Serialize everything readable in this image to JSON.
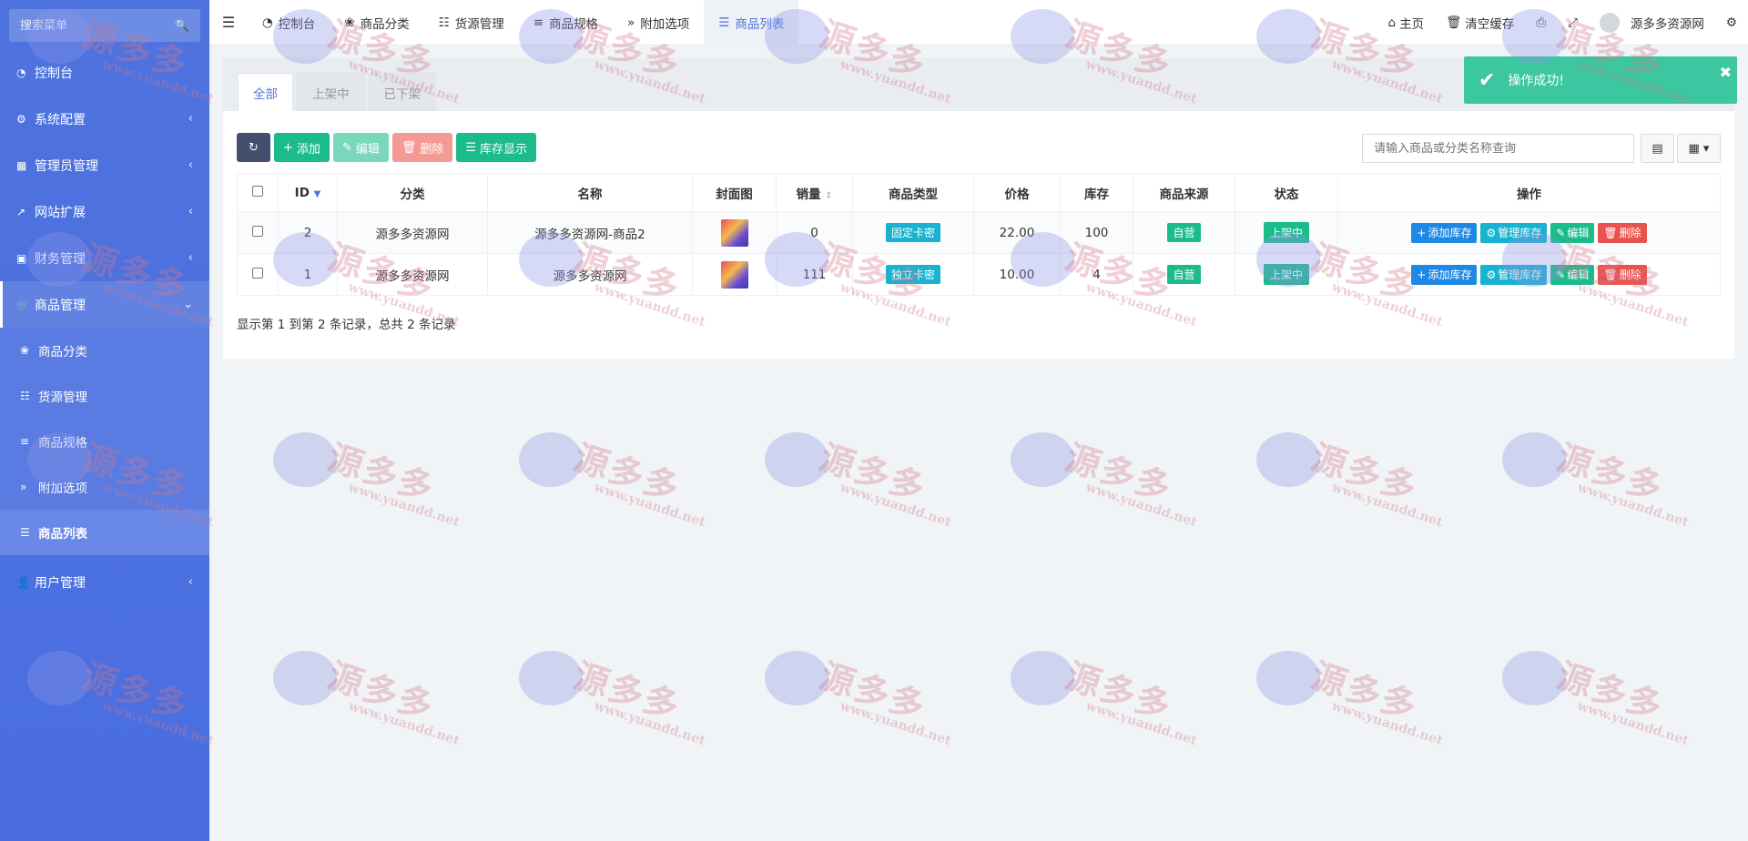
{
  "sidebar": {
    "search_placeholder": "搜索菜单",
    "items": [
      {
        "label": "控制台",
        "icon": "dashboard-icon"
      },
      {
        "label": "系统配置",
        "icon": "cogs-icon"
      },
      {
        "label": "管理员管理",
        "icon": "windows-icon"
      },
      {
        "label": "网站扩展",
        "icon": "external-link-icon"
      },
      {
        "label": "财务管理",
        "icon": "ledger-icon"
      },
      {
        "label": "商品管理",
        "icon": "cart-icon"
      }
    ],
    "sub_items": [
      {
        "label": "商品分类",
        "icon": "leaf-icon"
      },
      {
        "label": "货源管理",
        "icon": "sitemap-icon"
      },
      {
        "label": "商品规格",
        "icon": "sliders-icon"
      },
      {
        "label": "附加选项",
        "icon": "angle-double-right-icon"
      },
      {
        "label": "商品列表",
        "icon": "list-icon"
      }
    ],
    "user_mgmt": "用户管理"
  },
  "topbar": {
    "tabs": [
      "控制台",
      "商品分类",
      "货源管理",
      "商品规格",
      "附加选项",
      "商品列表"
    ],
    "home": "主页",
    "clear_cache": "清空缓存",
    "username": "源多多资源网"
  },
  "content": {
    "filter_tabs": [
      "全部",
      "上架中",
      "已下架"
    ],
    "toolbar": {
      "add": "添加",
      "edit": "编辑",
      "delete": "删除",
      "stock_display": "库存显示"
    },
    "search_placeholder": "请输入商品或分类名称查询",
    "columns": [
      "ID",
      "分类",
      "名称",
      "封面图",
      "销量",
      "商品类型",
      "价格",
      "库存",
      "商品来源",
      "状态",
      "操作"
    ],
    "rows": [
      {
        "id": "2",
        "category": "源多多资源网",
        "name": "源多多资源网-商品2",
        "sales": "0",
        "type": "固定卡密",
        "price": "22.00",
        "stock": "100",
        "source": "自营",
        "status": "上架中"
      },
      {
        "id": "1",
        "category": "源多多资源网",
        "name": "源多多资源网",
        "sales": "111",
        "type": "独立卡密",
        "price": "10.00",
        "stock": "4",
        "source": "自营",
        "status": "上架中"
      }
    ],
    "row_actions": {
      "add_stock": "添加库存",
      "manage_stock": "管理库存",
      "edit": "编辑",
      "delete": "删除"
    },
    "footer": "显示第 1 到第 2 条记录，总共 2 条记录"
  },
  "toast": {
    "message": "操作成功!"
  },
  "watermark": {
    "text": "源多多",
    "url": "www.yuandd.net"
  },
  "colors": {
    "sidebar": "#4e73df",
    "accent_green": "#1cbb8c",
    "danger": "#e8534d",
    "info": "#17b3d0",
    "primary": "#1e88e5"
  }
}
